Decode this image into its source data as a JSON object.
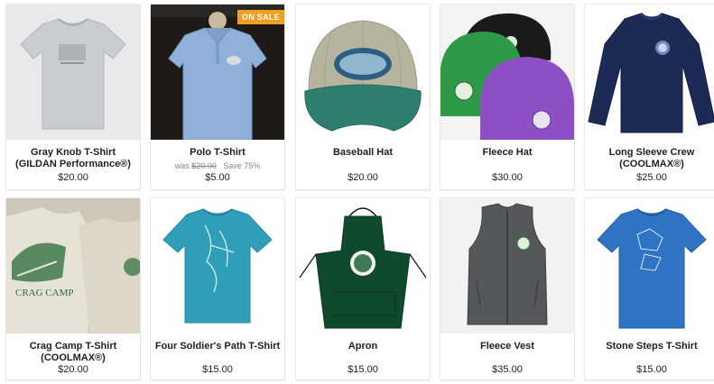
{
  "products": [
    {
      "title": "Gray Knob T-Shirt (GILDAN Performance®)",
      "price": "$20.00",
      "image_colors": {
        "bg": "#e7e9ea",
        "item": "#c9cdcf"
      }
    },
    {
      "title": "Polo T-Shirt",
      "price": "$5.00",
      "badge": "ON SALE",
      "was_label": "was",
      "was_price": "$20.00",
      "save": "Save 75%",
      "image_colors": {
        "bg": "#1d1a18",
        "item": "#8fb0d8"
      }
    },
    {
      "title": "Baseball Hat",
      "price": "$20.00",
      "image_colors": {
        "bg": "#ffffff",
        "item": "#b6b39f",
        "brim": "#2f7f70"
      }
    },
    {
      "title": "Fleece Hat",
      "price": "$30.00",
      "image_colors": {
        "bg": "#f4f4f4",
        "item": "#2e9a47",
        "item2": "#8f4fc4",
        "item3": "#1a1a1a"
      }
    },
    {
      "title": "Long Sleeve Crew (COOLMAX®)",
      "price": "$25.00",
      "image_colors": {
        "bg": "#ffffff",
        "item": "#1c2a55"
      }
    },
    {
      "title": "Crag Camp T-Shirt (COOLMAX®)",
      "price": "$20.00",
      "image_colors": {
        "bg": "#cfc8b8",
        "item": "#e7e2d6",
        "ink": "#2a6b3a"
      }
    },
    {
      "title": "Four Soldier's Path T-Shirt",
      "price": "$15.00",
      "image_colors": {
        "bg": "#ffffff",
        "item": "#2f9fb8"
      }
    },
    {
      "title": "Apron",
      "price": "$15.00",
      "image_colors": {
        "bg": "#ffffff",
        "item": "#0f4a2c"
      }
    },
    {
      "title": "Fleece Vest",
      "price": "$35.00",
      "image_colors": {
        "bg": "#f2f2f2",
        "item": "#55585a"
      }
    },
    {
      "title": "Stone Steps T-Shirt",
      "price": "$15.00",
      "image_colors": {
        "bg": "#ffffff",
        "item": "#2f73c4"
      }
    }
  ]
}
